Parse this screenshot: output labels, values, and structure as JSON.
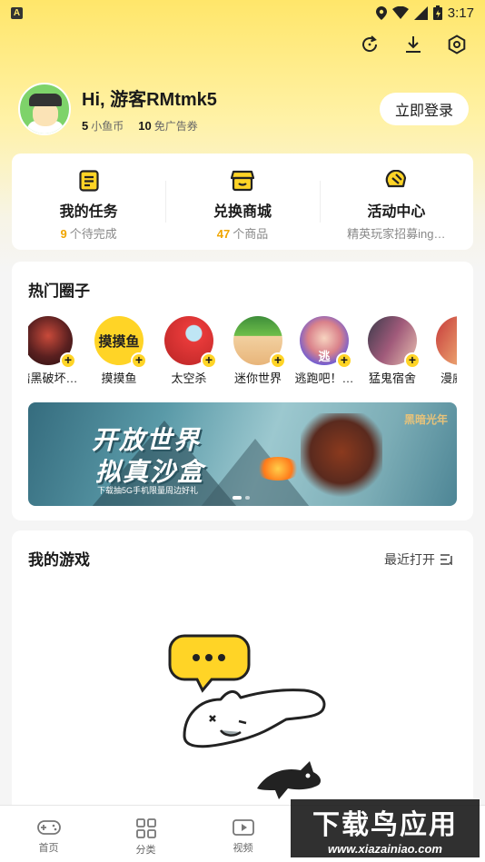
{
  "status_bar": {
    "time": "3:17",
    "app_icon_letter": "A"
  },
  "top_icons": [
    "refresh-icon",
    "download-icon",
    "settings-icon"
  ],
  "profile": {
    "greeting": "Hi, 游客RMtmk5",
    "fish_coin_count": "5",
    "fish_coin_label": "小鱼币",
    "ad_free_count": "10",
    "ad_free_label": "免广告券",
    "login_button": "立即登录"
  },
  "quick_actions": [
    {
      "icon": "task-list-icon",
      "title": "我的任务",
      "sub_num": "9",
      "sub_text": "个待完成"
    },
    {
      "icon": "shop-icon",
      "title": "兑换商城",
      "sub_num": "47",
      "sub_text": "个商品"
    },
    {
      "icon": "campaign-icon",
      "title": "活动中心",
      "sub_num": "",
      "sub_text": "精英玩家招募ing…"
    }
  ],
  "hot_circles": {
    "title": "热门圈子",
    "items": [
      {
        "label": "暗黑破坏…",
        "color": "#5a2020",
        "text": ""
      },
      {
        "label": "摸摸鱼",
        "color": "#ffd426",
        "text": "摸摸鱼"
      },
      {
        "label": "太空杀",
        "color": "#e83a3a",
        "text": ""
      },
      {
        "label": "迷你世界",
        "color": "#6fbf4a",
        "text": ""
      },
      {
        "label": "逃跑吧！…",
        "color": "#6b5bd6",
        "text": "逃"
      },
      {
        "label": "猛鬼宿舍",
        "color": "#a05a7a",
        "text": ""
      },
      {
        "label": "漫威",
        "color": "#c63a3a",
        "text": ""
      }
    ]
  },
  "banner": {
    "line1": "开放世界",
    "line2": "拟真沙盒",
    "line3": "下载抽5G手机限量周边好礼",
    "logo": "黑暗光年"
  },
  "my_games": {
    "title": "我的游戏",
    "sort_label": "最近打开"
  },
  "tabs": [
    {
      "icon": "gamepad-icon",
      "label": "首页"
    },
    {
      "icon": "grid-icon",
      "label": "分类"
    },
    {
      "icon": "video-icon",
      "label": "视频"
    }
  ],
  "watermark": {
    "main": "下载鸟应用",
    "sub": "www.xiazainiao.com"
  }
}
